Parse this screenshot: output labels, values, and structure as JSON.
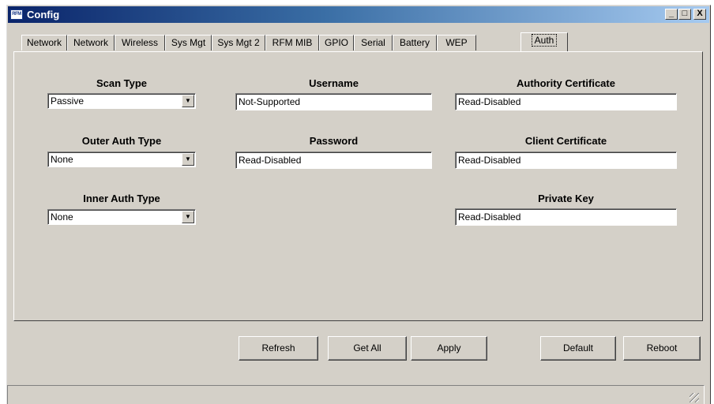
{
  "window": {
    "title": "Config",
    "app_icon_text": "RFM"
  },
  "caption": {
    "minimize": "_",
    "maximize": "□",
    "close": "X"
  },
  "tabs": [
    {
      "label": "Network"
    },
    {
      "label": "Network"
    },
    {
      "label": "Wireless"
    },
    {
      "label": "Sys Mgt"
    },
    {
      "label": "Sys Mgt 2"
    },
    {
      "label": "RFM MIB"
    },
    {
      "label": "GPIO"
    },
    {
      "label": "Serial"
    },
    {
      "label": "Battery"
    },
    {
      "label": "WEP"
    },
    {
      "label": "Auth"
    }
  ],
  "active_tab": "Auth",
  "fields": {
    "scan_type": {
      "label": "Scan Type",
      "value": "Passive"
    },
    "outer_auth_type": {
      "label": "Outer Auth Type",
      "value": "None"
    },
    "inner_auth_type": {
      "label": "Inner Auth Type",
      "value": "None"
    },
    "username": {
      "label": "Username",
      "value": "Not-Supported"
    },
    "password": {
      "label": "Password",
      "value": "Read-Disabled"
    },
    "authority_certificate": {
      "label": "Authority Certificate",
      "value": "Read-Disabled"
    },
    "client_certificate": {
      "label": "Client Certificate",
      "value": "Read-Disabled"
    },
    "private_key": {
      "label": "Private Key",
      "value": "Read-Disabled"
    }
  },
  "buttons": {
    "refresh": "Refresh",
    "get_all": "Get All",
    "apply": "Apply",
    "default": "Default",
    "reboot": "Reboot"
  },
  "icons": {
    "dropdown_arrow": "▼"
  },
  "colors": {
    "title_start": "#0a246a",
    "title_end": "#a6caf0",
    "face": "#d4d0c8"
  }
}
